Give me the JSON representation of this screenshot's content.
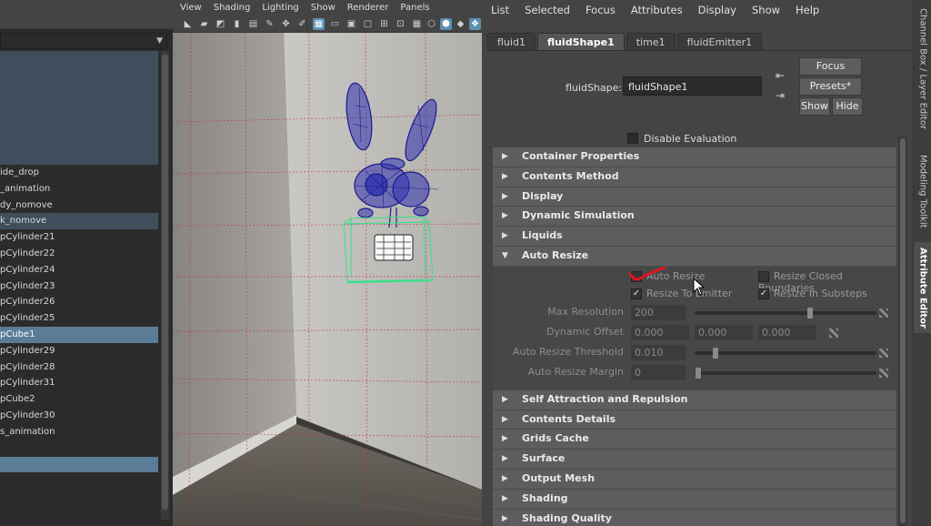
{
  "outliner": {
    "rows": [
      "ide_drop",
      "_animation",
      "dy_nomove",
      "k_nomove",
      "pCylinder21",
      "pCylinder22",
      "pCylinder24",
      "pCylinder23",
      "pCylinder26",
      "pCylinder25",
      "pCube1",
      "pCylinder29",
      "pCylinder28",
      "pCylinder31",
      "pCube2",
      "pCylinder30",
      "s_animation"
    ]
  },
  "viewport": {
    "menu": [
      "View",
      "Shading",
      "Lighting",
      "Show",
      "Renderer",
      "Panels"
    ]
  },
  "ae": {
    "menu": [
      "List",
      "Selected",
      "Focus",
      "Attributes",
      "Display",
      "Show",
      "Help"
    ],
    "tabs": [
      "fluid1",
      "fluidShape1",
      "time1",
      "fluidEmitter1"
    ],
    "shape_label": "fluidShape:",
    "shape_value": "fluidShape1",
    "buttons": {
      "focus": "Focus",
      "presets": "Presets*",
      "show": "Show",
      "hide": "Hide"
    },
    "disable_eval": "Disable Evaluation",
    "sections_before": [
      "Container Properties",
      "Contents Method",
      "Display",
      "Dynamic Simulation",
      "Liquids"
    ],
    "auto_resize": {
      "title": "Auto Resize",
      "auto_resize_label": "Auto Resize",
      "resize_closed_label": "Resize Closed Boundaries",
      "resize_to_emitter_label": "Resize To Emitter",
      "resize_in_substeps_label": "Resize In Substeps",
      "max_resolution_label": "Max Resolution",
      "max_resolution_value": "200",
      "dynamic_offset_label": "Dynamic Offset",
      "dynamic_offset_values": [
        "0.000",
        "0.000",
        "0.000"
      ],
      "threshold_label": "Auto Resize Threshold",
      "threshold_value": "0.010",
      "margin_label": "Auto Resize Margin",
      "margin_value": "0"
    },
    "sections_after": [
      "Self Attraction and Repulsion",
      "Contents Details",
      "Grids Cache",
      "Surface",
      "Output Mesh",
      "Shading",
      "Shading Quality"
    ]
  },
  "dock": {
    "tabs": [
      "Channel Box / Layer Editor",
      "Modeling Toolkit",
      "Attribute Editor"
    ]
  },
  "colors": {
    "selection": "#5a7c97",
    "wireframe": "#1c1c8c",
    "bbox": "#3ce08a",
    "annotation": "#e0141e"
  }
}
